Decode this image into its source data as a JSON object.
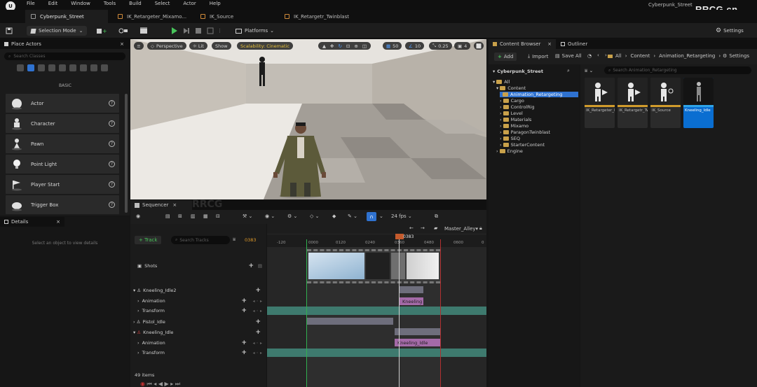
{
  "menu": {
    "logo_text": "U",
    "items": [
      "File",
      "Edit",
      "Window",
      "Tools",
      "Build",
      "Select",
      "Actor",
      "Help"
    ],
    "project_name": "Cyberpunk_Street",
    "watermark": "RRCG.cn"
  },
  "tabs": [
    {
      "label": "Cyberpunk_Street",
      "active": true
    },
    {
      "label": "IK_Retargeter_Mixamo...",
      "active": false
    },
    {
      "label": "IK_Source",
      "active": false
    },
    {
      "label": "IK_Retargetr_Twinblast",
      "active": false
    }
  ],
  "toolbar": {
    "selection_mode": "Selection Mode",
    "platforms": "Platforms",
    "settings": "Settings"
  },
  "place_actors": {
    "tab_label": "Place Actors",
    "search_placeholder": "Search Classes",
    "category_label": "BASIC",
    "items": [
      {
        "label": "Actor",
        "icon": "sphere-icon"
      },
      {
        "label": "Character",
        "icon": "character-icon"
      },
      {
        "label": "Pawn",
        "icon": "pawn-icon"
      },
      {
        "label": "Point Light",
        "icon": "lightbulb-icon"
      },
      {
        "label": "Player Start",
        "icon": "flag-icon"
      },
      {
        "label": "Trigger Box",
        "icon": "trigger-icon"
      }
    ]
  },
  "details": {
    "tab_label": "Details",
    "empty_text": "Select an object to view details"
  },
  "viewport": {
    "perspective": "Perspective",
    "lit": "Lit",
    "show": "Show",
    "scalability": "Scalability: Cinematic",
    "grid_snap": "50",
    "rot_snap": "10",
    "scale_snap": "0.25",
    "camera_speed": "4"
  },
  "sequencer": {
    "tab_label": "Sequencer",
    "fps": "24 fps",
    "sequence_name": "Master_Alley",
    "add_track": "+ Track",
    "search_placeholder": "Search Tracks",
    "current_frame": "0383",
    "playhead_label": "0383",
    "ruler_ticks": [
      "-120",
      "0000",
      "0120",
      "0240",
      "0360",
      "0480",
      "0600",
      "0"
    ],
    "items_count": "49 items",
    "tracks": [
      {
        "label": "Shots",
        "indent": 0,
        "plus": true
      },
      {
        "label": "Kneeling_Idle2",
        "indent": 0,
        "plus": true
      },
      {
        "label": "Animation",
        "indent": 1,
        "plus": true
      },
      {
        "label": "Transform",
        "indent": 1,
        "plus": true
      },
      {
        "label": "Pistol_Idle",
        "indent": 0,
        "plus": true
      },
      {
        "label": "Kneeling_Idle",
        "indent": 0,
        "plus": true
      },
      {
        "label": "Animation",
        "indent": 1,
        "plus": true
      },
      {
        "label": "Transform",
        "indent": 1,
        "plus": true
      }
    ],
    "clips": {
      "kneeling": "Kneeling",
      "kneeling_idle": "Kneeling_Idle"
    },
    "overlay_watermark": "RRCG"
  },
  "content_browser": {
    "tab_label": "Content Browser",
    "outliner_label": "Outliner",
    "add": "Add",
    "import": "Import",
    "save_all": "Save All",
    "breadcrumb": [
      "All",
      "Content",
      "Animation_Retargeting"
    ],
    "settings": "Settings",
    "tree_root": "Cyberpunk_Street",
    "search_placeholder": "Search Animation_Retargeting",
    "tree": [
      {
        "label": "All",
        "indent": 0
      },
      {
        "label": "Content",
        "indent": 1
      },
      {
        "label": "Animation_Retargeting",
        "indent": 2,
        "selected": true
      },
      {
        "label": "Cargo",
        "indent": 2
      },
      {
        "label": "ControlRig",
        "indent": 2
      },
      {
        "label": "Level",
        "indent": 2
      },
      {
        "label": "Materials",
        "indent": 2
      },
      {
        "label": "Mixamo",
        "indent": 2
      },
      {
        "label": "ParagonTwinblast",
        "indent": 2
      },
      {
        "label": "SEQ",
        "indent": 2
      },
      {
        "label": "StarterContent",
        "indent": 2
      },
      {
        "label": "Engine",
        "indent": 1
      }
    ],
    "assets": [
      {
        "label": "IK_Retargeter_Mixamo_To_Twinblast",
        "selected": false
      },
      {
        "label": "IK_Retargetr_Twinblast",
        "selected": false
      },
      {
        "label": "IK_Source",
        "selected": false
      },
      {
        "label": "Kneeling_Idle",
        "selected": true
      }
    ],
    "accent": "#0a6ed1"
  }
}
